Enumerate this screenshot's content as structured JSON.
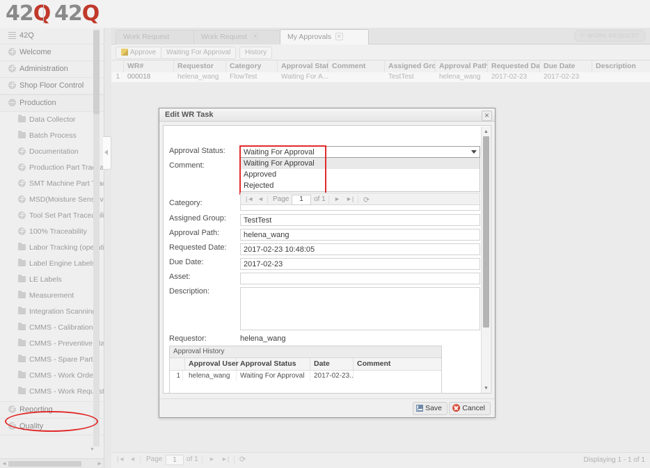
{
  "brand": {
    "logo_primary_text": "42",
    "logo_accent_text": "Q",
    "logo_gray_hex": "#8a8a8a",
    "logo_red_hex": "#c0392b"
  },
  "sidebar": {
    "root_label": "42Q",
    "top_items": [
      {
        "label": "Welcome",
        "icon": "plus-circle-icon"
      },
      {
        "label": "Administration",
        "icon": "plus-circle-icon"
      },
      {
        "label": "Shop Floor Control",
        "icon": "plus-circle-icon"
      }
    ],
    "expanded_group": {
      "label": "Production",
      "icon": "minus-circle-icon"
    },
    "children": [
      {
        "label": "Data Collector",
        "icon": "folder-icon"
      },
      {
        "label": "Batch Process",
        "icon": "folder-icon"
      },
      {
        "label": "Documentation",
        "icon": "plus-circle-icon"
      },
      {
        "label": "Production Part Traceab",
        "icon": "plus-circle-icon"
      },
      {
        "label": "SMT Machine Part Trace",
        "icon": "plus-circle-icon"
      },
      {
        "label": "MSD(Moisture Sensitive D",
        "icon": "plus-circle-icon"
      },
      {
        "label": "Tool Set Part Traceabilit",
        "icon": "plus-circle-icon"
      },
      {
        "label": "100% Traceability",
        "icon": "plus-circle-icon"
      },
      {
        "label": "Labor Tracking (operatio",
        "icon": "folder-icon"
      },
      {
        "label": "Label Engine Labels",
        "icon": "folder-icon"
      },
      {
        "label": "LE Labels",
        "icon": "folder-icon"
      },
      {
        "label": "Measurement",
        "icon": "folder-icon"
      },
      {
        "label": "Integration Scanning",
        "icon": "folder-icon"
      },
      {
        "label": "CMMS - Calibration",
        "icon": "folder-icon"
      },
      {
        "label": "CMMS - Preventive Maint",
        "icon": "folder-icon"
      },
      {
        "label": "CMMS - Spare Parts",
        "icon": "folder-icon"
      },
      {
        "label": "CMMS - Work Order",
        "icon": "folder-icon"
      },
      {
        "label": "CMMS - Work Request",
        "icon": "folder-icon"
      }
    ],
    "bottom_items": [
      {
        "label": "Reporting",
        "icon": "plus-circle-icon"
      },
      {
        "label": "Quality",
        "icon": "plus-circle-icon"
      }
    ],
    "highlight_color_hex": "#e02b2b",
    "highlighted_item": "CMMS - Work Request"
  },
  "tabs": [
    {
      "label": "Work Request",
      "active": false,
      "closable": false
    },
    {
      "label": "Work Request",
      "active": false,
      "closable": true
    },
    {
      "label": "My Approvals",
      "active": true,
      "closable": true
    }
  ],
  "header_action": {
    "label": "WORK REQUEST",
    "icon": "move-cross-icon"
  },
  "toolbar": {
    "approve_label": "Approve",
    "approve_icon": "pencil-icon",
    "waiting_label": "Waiting For Approval",
    "history_label": "History"
  },
  "grid": {
    "columns": [
      "WR#",
      "Requestor",
      "Category",
      "Approval Statu",
      "Comment",
      "Assigned Group",
      "Approval Path",
      "Requested Dat",
      "Due Date",
      "Description"
    ],
    "rows": [
      {
        "num": "1",
        "wr": "000018",
        "requestor": "helena_wang",
        "category": "FlowTest",
        "approval_status": "Waiting For A...",
        "comment": "",
        "assigned_group": "TestTest",
        "approval_path": "helena_wang",
        "requested_date": "2017-02-23",
        "due_date": "2017-02-23",
        "description": ""
      }
    ]
  },
  "statusbar": {
    "page_label": "Page",
    "page_value": "1",
    "of_label": "of 1",
    "displaying": "Displaying 1 - 1 of 1",
    "refresh_icon": "refresh-icon",
    "first_icon": "first-page-icon",
    "prev_icon": "prev-page-icon",
    "next_icon": "next-page-icon",
    "last_icon": "last-page-icon"
  },
  "dialog": {
    "title": "Edit WR Task",
    "close_icon": "close-icon",
    "fields": {
      "approval_status_label": "Approval Status:",
      "approval_status_value": "Waiting For Approval",
      "comment_label": "Comment:",
      "category_label": "Category:",
      "category_value": "",
      "assigned_group_label": "Assigned Group:",
      "assigned_group_value": "TestTest",
      "approval_path_label": "Approval Path:",
      "approval_path_value": "helena_wang",
      "requested_date_label": "Requested Date:",
      "requested_date_value": "2017-02-23 10:48:05",
      "due_date_label": "Due Date:",
      "due_date_value": "2017-02-23",
      "asset_label": "Asset:",
      "asset_value": "",
      "description_label": "Description:",
      "description_value": "",
      "requestor_label": "Requestor:",
      "requestor_value": "helena_wang"
    },
    "dropdown": {
      "open": true,
      "options": [
        "Waiting For Approval",
        "Approved",
        "Rejected"
      ],
      "selected_index": 0,
      "caret_icon": "chevron-down-icon",
      "highlight_color_hex": "#e02b2b"
    },
    "mini_pager": {
      "page_label": "Page",
      "page_value": "1",
      "of_label": "of 1",
      "refresh_icon": "refresh-icon"
    },
    "approval_history": {
      "title": "Approval History",
      "columns": [
        "Approval User",
        "Approval Status",
        "Date",
        "Comment"
      ],
      "rows": [
        {
          "num": "1",
          "approval_user": "helena_wang",
          "approval_status": "Waiting For Approval",
          "date": "2017-02-23...",
          "comment": ""
        }
      ]
    },
    "footer": {
      "save_label": "Save",
      "save_icon": "floppy-disk-icon",
      "cancel_label": "Cancel",
      "cancel_icon": "cancel-circle-icon"
    },
    "scrollbar": {
      "up_icon": "scroll-up-icon",
      "down_icon": "scroll-down-icon"
    }
  }
}
